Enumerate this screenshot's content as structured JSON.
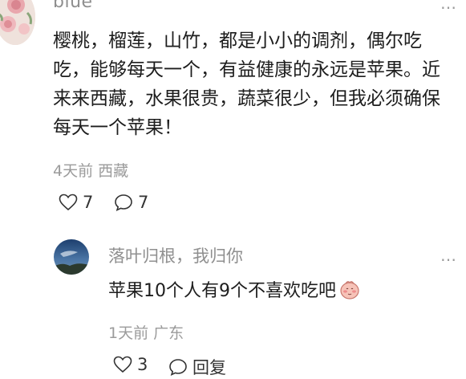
{
  "comment": {
    "username": "blue",
    "text": "樱桃，榴莲，山竹，都是小小的调剂，偶尔吃吃，能够每天一个，有益健康的永远是苹果。近来来西藏，水果很贵，蔬菜很少，但我必须确保每天一个苹果！",
    "time": "4天前",
    "location": "西藏",
    "likes": "7",
    "replies": "7",
    "more_icon": "…"
  },
  "reply": {
    "username": "落叶归根，我归你",
    "text": "苹果10个人有9个不喜欢吃吧",
    "emoji_icon": "blushing-face-icon",
    "time": "1天前",
    "location": "广东",
    "likes": "3",
    "reply_label": "回复",
    "more_icon": "…"
  }
}
